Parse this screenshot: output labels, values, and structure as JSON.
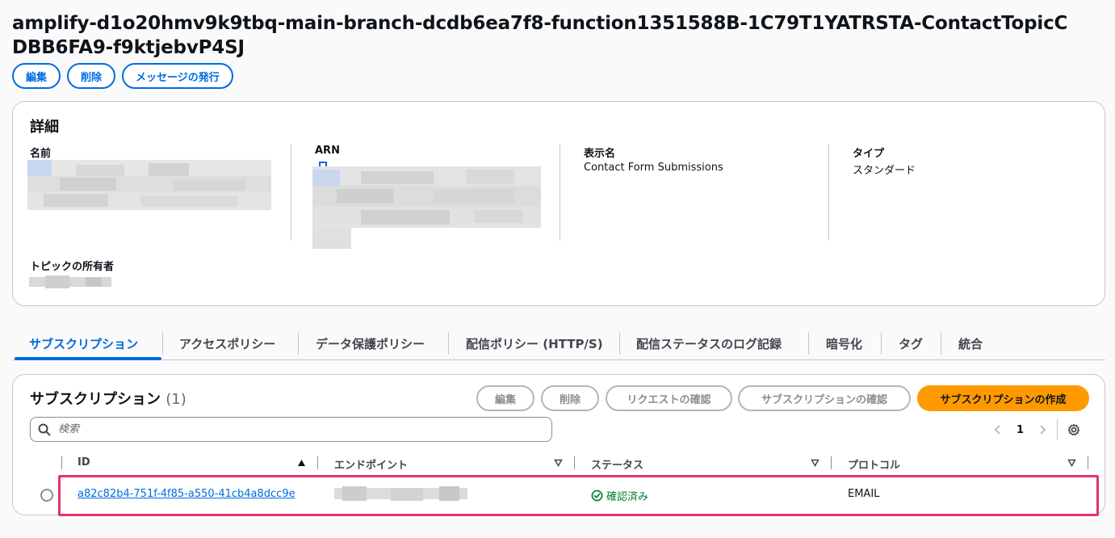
{
  "page": {
    "title": "amplify-d1o20hmv9k9tbq-main-branch-dcdb6ea7f8-function1351588B-1C79T1YATRSTA-ContactTopicCDBB6FA9-f9ktjebvP4SJ"
  },
  "actions": {
    "edit": "編集",
    "delete": "削除",
    "publish": "メッセージの発行"
  },
  "details": {
    "title": "詳細",
    "name_label": "名前",
    "arn_label": "ARN",
    "display_name_label": "表示名",
    "display_name_value": "Contact Form Submissions",
    "type_label": "タイプ",
    "type_value": "スタンダード",
    "owner_label": "トピックの所有者"
  },
  "tabs": [
    {
      "label": "サブスクリプション",
      "active": true
    },
    {
      "label": "アクセスポリシー",
      "active": false
    },
    {
      "label": "データ保護ポリシー",
      "active": false
    },
    {
      "label": "配信ポリシー (HTTP/S)",
      "active": false
    },
    {
      "label": "配信ステータスのログ記録",
      "active": false
    },
    {
      "label": "暗号化",
      "active": false
    },
    {
      "label": "タグ",
      "active": false
    },
    {
      "label": "統合",
      "active": false
    }
  ],
  "subscriptions": {
    "title": "サブスクリプション",
    "count": "(1)",
    "buttons": {
      "edit": "編集",
      "delete": "削除",
      "confirm_request": "リクエストの確認",
      "confirm_subscription": "サブスクリプションの確認",
      "create": "サブスクリプションの作成"
    },
    "search_placeholder": "検索",
    "page_number": "1",
    "columns": [
      "ID",
      "エンドポイント",
      "ステータス",
      "プロトコル"
    ],
    "rows": [
      {
        "id": "a82c82b4-751f-4f85-a550-41cb4a8dcc9e",
        "status": "確認済み",
        "protocol": "EMAIL"
      }
    ]
  },
  "colors": {
    "accent": "#006ce0",
    "primary_button": "#ff9900",
    "success": "#00802f",
    "highlight": "#e6316e"
  }
}
